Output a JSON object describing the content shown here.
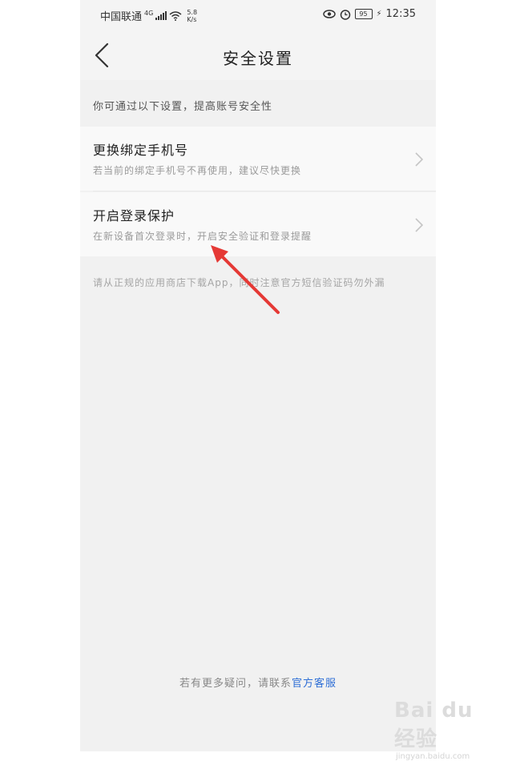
{
  "status": {
    "carrier": "中国联通",
    "network": "4G",
    "speed_value": "5.8",
    "speed_unit": "K/s",
    "battery": "95",
    "time": "12:35"
  },
  "header": {
    "title": "安全设置",
    "back_icon": "chevron-left-icon"
  },
  "hint": "你可通过以下设置，提高账号安全性",
  "settings": [
    {
      "title": "更换绑定手机号",
      "subtitle": "若当前的绑定手机号不再使用，建议尽快更换"
    },
    {
      "title": "开启登录保护",
      "subtitle": "在新设备首次登录时，开启安全验证和登录提醒"
    }
  ],
  "note": "请从正规的应用商店下载App，同时注意官方短信验证码勿外漏",
  "footer": {
    "prefix": "若有更多疑问，请联系",
    "link": "官方客服"
  },
  "watermark": {
    "main": "Bai du 经验",
    "sub": "jingyan.baidu.com"
  },
  "colors": {
    "annotation_arrow": "#e53935",
    "link": "#2f6fd6"
  }
}
